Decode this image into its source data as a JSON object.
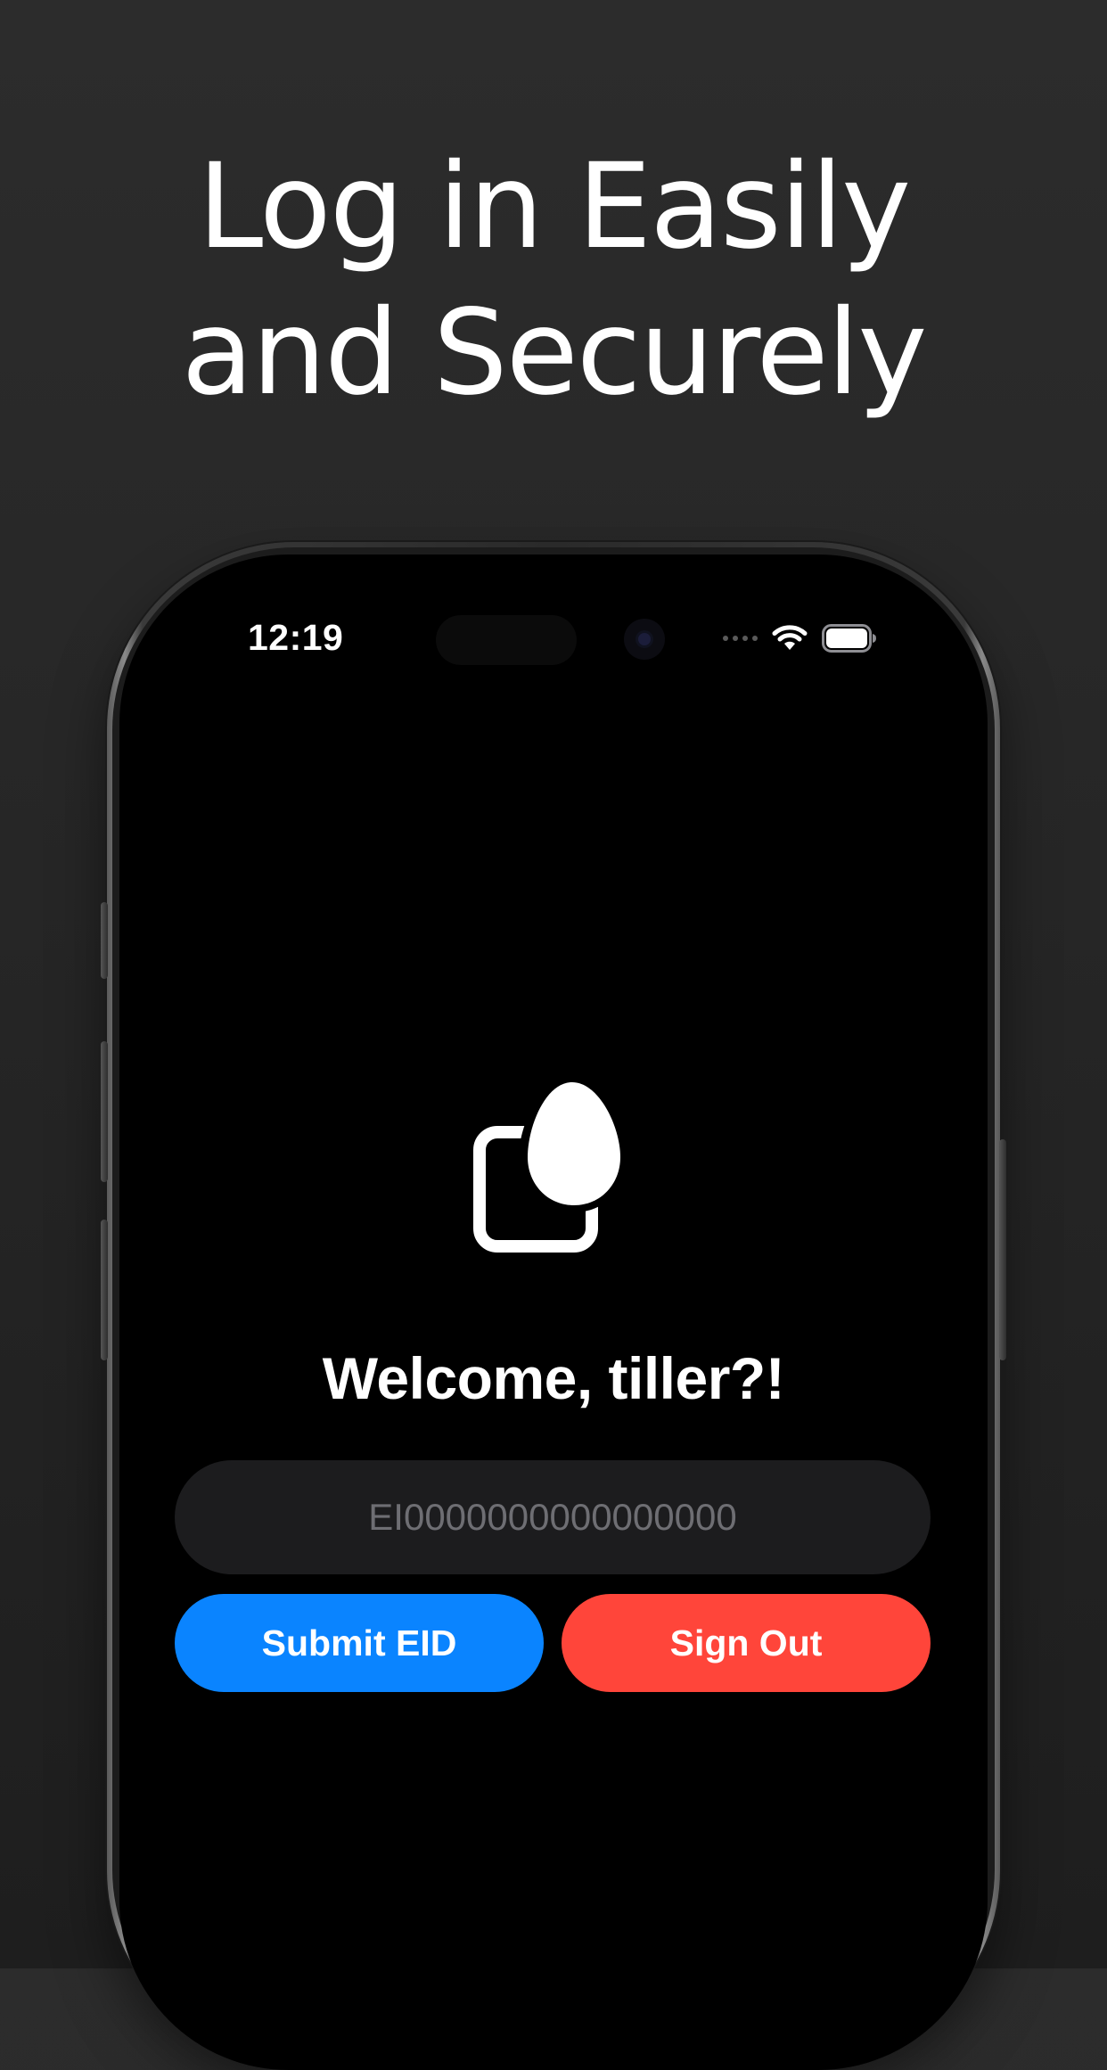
{
  "headline": {
    "line1": "Log in Easily",
    "line2": "and Securely"
  },
  "status_bar": {
    "time": "12:19",
    "icons": [
      "cellular-signal-icon",
      "wifi-icon",
      "battery-icon"
    ]
  },
  "app": {
    "logo_icon": "egg-and-basket-icon",
    "welcome_text": "Welcome, tiller?!",
    "eid_input": {
      "placeholder": "EI0000000000000000",
      "value": ""
    },
    "submit_label": "Submit EID",
    "signout_label": "Sign Out"
  },
  "colors": {
    "background": "#262626",
    "screen": "#000000",
    "input_bg": "#1c1c1e",
    "placeholder": "#6e6e73",
    "submit": "#0a84ff",
    "signout": "#ff453a",
    "text": "#ffffff"
  }
}
